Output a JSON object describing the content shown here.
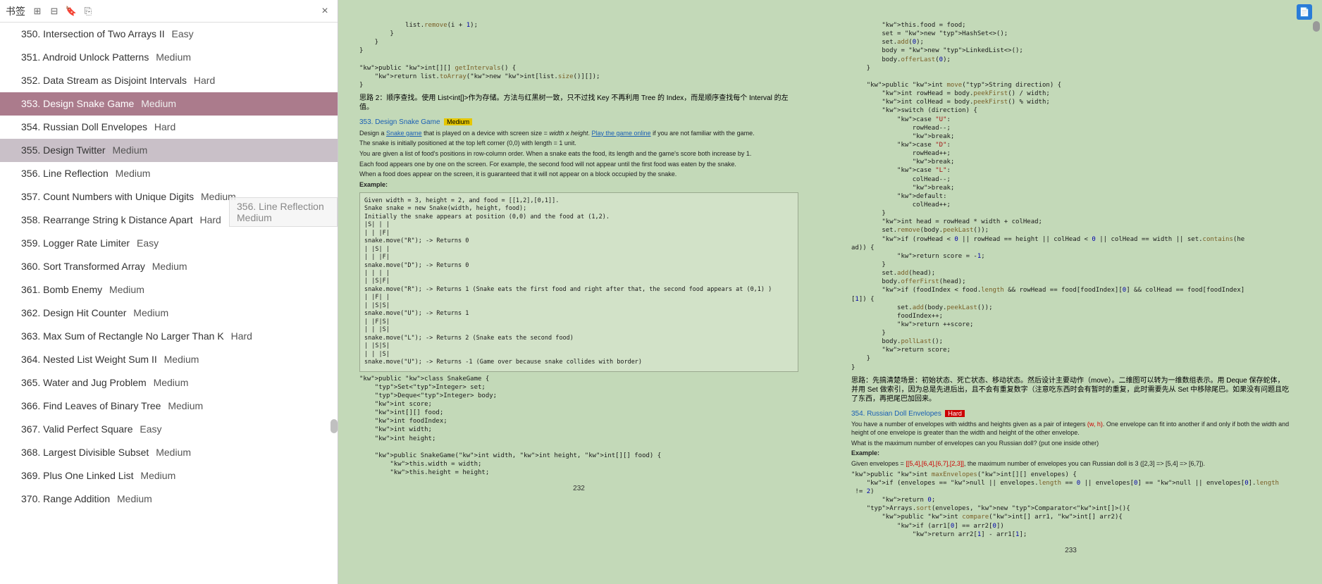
{
  "sidebar": {
    "title": "书签",
    "close_label": "×",
    "items": [
      {
        "n": "350",
        "t": "Intersection of Two Arrays II",
        "d": "Easy"
      },
      {
        "n": "351",
        "t": "Android Unlock Patterns",
        "d": "Medium"
      },
      {
        "n": "352",
        "t": "Data Stream as Disjoint Intervals",
        "d": "Hard"
      },
      {
        "n": "353",
        "t": "Design Snake Game",
        "d": "Medium",
        "selected": true
      },
      {
        "n": "354",
        "t": "Russian Doll Envelopes",
        "d": "Hard"
      },
      {
        "n": "355",
        "t": "Design Twitter",
        "d": "Medium",
        "highlighted": true
      },
      {
        "n": "356",
        "t": "Line Reflection",
        "d": "Medium"
      },
      {
        "n": "357",
        "t": "Count Numbers with Unique Digits",
        "d": "Medium"
      },
      {
        "n": "358",
        "t": "Rearrange String k Distance Apart",
        "d": "Hard"
      },
      {
        "n": "359",
        "t": "Logger Rate Limiter",
        "d": "Easy"
      },
      {
        "n": "360",
        "t": "Sort Transformed Array",
        "d": "Medium"
      },
      {
        "n": "361",
        "t": "Bomb Enemy",
        "d": "Medium"
      },
      {
        "n": "362",
        "t": "Design Hit Counter",
        "d": "Medium"
      },
      {
        "n": "363",
        "t": "Max Sum of Rectangle No Larger Than K",
        "d": "Hard"
      },
      {
        "n": "364",
        "t": "Nested List Weight Sum II",
        "d": "Medium"
      },
      {
        "n": "365",
        "t": "Water and Jug Problem",
        "d": "Medium"
      },
      {
        "n": "366",
        "t": "Find Leaves of Binary Tree",
        "d": "Medium"
      },
      {
        "n": "367",
        "t": "Valid Perfect Square",
        "d": "Easy"
      },
      {
        "n": "368",
        "t": "Largest Divisible Subset",
        "d": "Medium"
      },
      {
        "n": "369",
        "t": "Plus One Linked List",
        "d": "Medium"
      },
      {
        "n": "370",
        "t": "Range Addition",
        "d": "Medium"
      }
    ]
  },
  "tooltip": "356. Line Reflection   Medium",
  "left_page": {
    "code1_lines": [
      "            list.remove(i + 1);",
      "        }",
      "    }",
      "}",
      "",
      "public int[][] getIntervals() {",
      "    return list.toArray(new int[list.size()][]);",
      "}"
    ],
    "thinking1": "思路 2：顺序查找。使用 List<int[]>作为存储。方法与红黑树一致，只不过找 Key 不再利用 Tree 的 Index，而是顺序查找每个 Interval 的左值。",
    "p353_title_num": "353. Design Snake Game",
    "p353_diff": "Medium",
    "p353_line1a": "Design a ",
    "p353_link1": "Snake game",
    "p353_line1b": " that is played on a device with screen size = ",
    "p353_line1c": "width x height",
    "p353_line1d": ". ",
    "p353_link2": "Play the game online",
    "p353_line1e": " if you are not familiar with the game.",
    "p353_line2": "The snake is initially positioned at the top left corner (0,0) with length = 1 unit.",
    "p353_line3": "You are given a list of food's positions in row-column order. When a snake eats the food, its length and the game's score both increase by 1.",
    "p353_line4": "Each food appears one by one on the screen. For example, the second food will not appear until the first food was eaten by the snake.",
    "p353_line5": "When a food does appear on the screen, it is guaranteed that it will not appear on a block occupied by the snake.",
    "p353_example_label": "Example:",
    "example_box": "Given width = 3, height = 2, and food = [[1,2],[0,1]].\nSnake snake = new Snake(width, height, food);\nInitially the snake appears at position (0,0) and the food at (1,2).\n|S| | |\n| | |F|\nsnake.move(\"R\"); -> Returns 0\n| |S| |\n| | |F|\nsnake.move(\"D\"); -> Returns 0\n| | | |\n| |S|F|\nsnake.move(\"R\"); -> Returns 1 (Snake eats the first food and right after that, the second food appears at (0,1) )\n| |F| |\n| |S|S|\nsnake.move(\"U\"); -> Returns 1\n| |F|S|\n| | |S|\nsnake.move(\"L\"); -> Returns 2 (Snake eats the second food)\n| |S|S|\n| | |S|\nsnake.move(\"U\"); -> Returns -1 (Game over because snake collides with border)",
    "code2_lines": [
      "public class SnakeGame {",
      "    Set<Integer> set;",
      "    Deque<Integer> body;",
      "    int score;",
      "    int[][] food;",
      "    int foodIndex;",
      "    int width;",
      "    int height;",
      "",
      "    public SnakeGame(int width, int height, int[][] food) {",
      "        this.width = width;",
      "        this.height = height;"
    ],
    "page_num": "232"
  },
  "right_page": {
    "code1_lines": [
      "        this.food = food;",
      "        set = new HashSet<>();",
      "        set.add(0);",
      "        body = new LinkedList<>();",
      "        body.offerLast(0);",
      "    }",
      "",
      "    public int move(String direction) {",
      "        int rowHead = body.peekFirst() / width;",
      "        int colHead = body.peekFirst() % width;",
      "        switch (direction) {",
      "            case \"U\":",
      "                rowHead--;",
      "                break;",
      "            case \"D\":",
      "                rowHead++;",
      "                break;",
      "            case \"L\":",
      "                colHead--;",
      "                break;",
      "            default:",
      "                colHead++;",
      "        }",
      "        int head = rowHead * width + colHead;",
      "        set.remove(body.peekLast());",
      "        if (rowHead < 0 || rowHead == height || colHead < 0 || colHead == width || set.contains(he",
      "ad)) {",
      "            return score = -1;",
      "        }",
      "        set.add(head);",
      "        body.offerFirst(head);",
      "        if (foodIndex < food.length && rowHead == food[foodIndex][0] && colHead == food[foodIndex]",
      "[1]) {",
      "            set.add(body.peekLast());",
      "            foodIndex++;",
      "            return ++score;",
      "        }",
      "        body.pollLast();",
      "        return score;",
      "    }",
      "}"
    ],
    "thinking1": "思路：先搞清楚场景：初始状态、死亡状态、移动状态。然后设计主要动作（move）。二维图可以转为一维数组表示。用 Deque 保存蛇体，并用 Set 做索引，因为总是先进后出，且不会有重复数字（注意吃东西时会有暂时的重复，此时需要先从 Set 中移除尾巴。如果没有问题且吃了东西，再把尾巴加回来。",
    "p354_title_num": "354. Russian Doll Envelopes",
    "p354_diff": "Hard",
    "p354_line1a": "You have a number of envelopes with widths and heights given as a pair of integers ",
    "p354_line1b": "(w, h)",
    "p354_line1c": ". One envelope can fit into another if and only if both the width and height of one envelope is greater than the width and height of the other envelope.",
    "p354_line2": "What is the maximum number of envelopes can you Russian doll? (put one inside other)",
    "p354_example_label": "Example:",
    "p354_line3a": "Given envelopes = ",
    "p354_line3b": "[[5,4],[6,4],[6,7],[2,3]]",
    "p354_line3c": ", the maximum number of envelopes you can Russian doll is 3 ([2,3] => [5,4] => [6,7]).",
    "code2_lines": [
      "public int maxEnvelopes(int[][] envelopes) {",
      "    if (envelopes == null || envelopes.length == 0 || envelopes[0] == null || envelopes[0].length",
      " != 2)",
      "        return 0;",
      "    Arrays.sort(envelopes, new Comparator<int[]>(){",
      "        public int compare(int[] arr1, int[] arr2){",
      "            if (arr1[0] == arr2[0])",
      "                return arr2[1] - arr1[1];"
    ],
    "page_num": "233"
  }
}
